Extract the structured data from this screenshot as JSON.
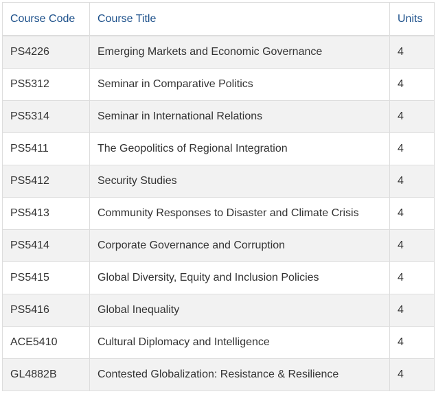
{
  "table": {
    "headers": {
      "code": "Course Code",
      "title": "Course Title",
      "units": "Units"
    },
    "rows": [
      {
        "code": "PS4226",
        "title": "Emerging Markets and Economic Governance",
        "units": "4"
      },
      {
        "code": "PS5312",
        "title": "Seminar in Comparative Politics",
        "units": "4"
      },
      {
        "code": "PS5314",
        "title": "Seminar in International Relations",
        "units": "4"
      },
      {
        "code": "PS5411",
        "title": "The Geopolitics of Regional Integration",
        "units": "4"
      },
      {
        "code": "PS5412",
        "title": "Security Studies",
        "units": "4"
      },
      {
        "code": "PS5413",
        "title": "Community Responses to Disaster and Climate Crisis",
        "units": "4"
      },
      {
        "code": "PS5414",
        "title": "Corporate Governance and Corruption",
        "units": "4"
      },
      {
        "code": "PS5415",
        "title": "Global Diversity, Equity and Inclusion Policies",
        "units": "4"
      },
      {
        "code": "PS5416",
        "title": "Global Inequality",
        "units": "4"
      },
      {
        "code": "ACE5410",
        "title": "Cultural Diplomacy and Intelligence",
        "units": "4"
      },
      {
        "code": "GL4882B",
        "title": "Contested Globalization: Resistance & Resilience",
        "units": "4"
      }
    ]
  },
  "colors": {
    "header_text": "#1b4f8a",
    "row_stripe": "#f2f2f2",
    "border": "#dddddd"
  }
}
